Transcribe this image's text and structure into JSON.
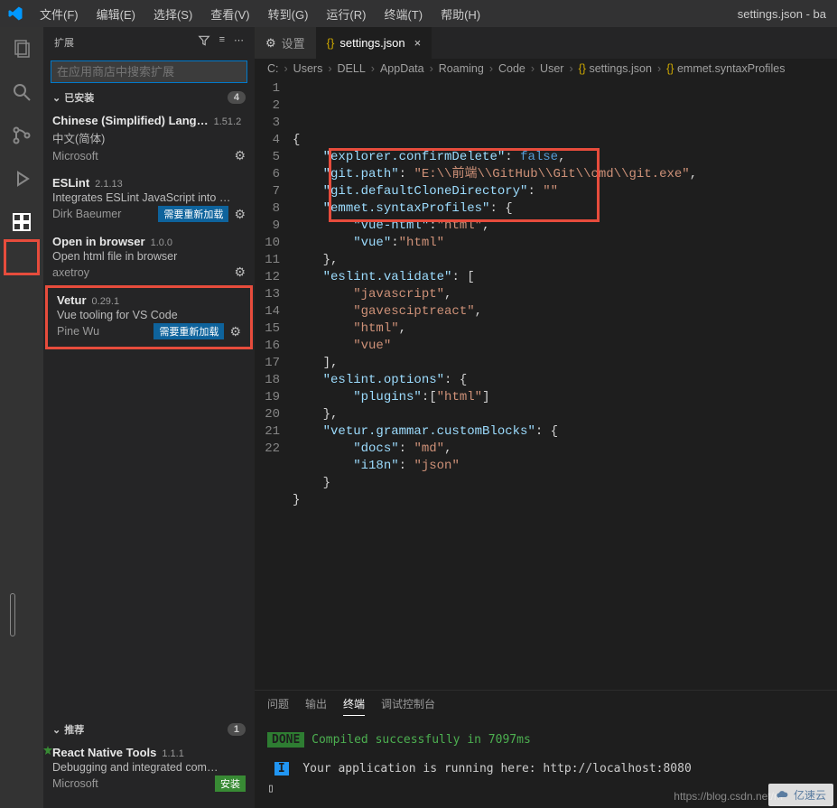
{
  "titlebar": {
    "menus": [
      "文件(F)",
      "编辑(E)",
      "选择(S)",
      "查看(V)",
      "转到(G)",
      "运行(R)",
      "终端(T)",
      "帮助(H)"
    ],
    "window_title": "settings.json - ba"
  },
  "sidebar": {
    "title": "扩展",
    "search_placeholder": "在应用商店中搜索扩展",
    "installed_label": "已安装",
    "installed_count": "4",
    "recommended_label": "推荐",
    "recommended_count": "1",
    "extensions": [
      {
        "name": "Chinese (Simplified) Lang…",
        "version": "1.51.2",
        "desc": "中文(简体)",
        "publisher": "Microsoft",
        "reload": false
      },
      {
        "name": "ESLint",
        "version": "2.1.13",
        "desc": "Integrates ESLint JavaScript into …",
        "publisher": "Dirk Baeumer",
        "reload": true
      },
      {
        "name": "Open in browser",
        "version": "1.0.0",
        "desc": "Open html file in browser",
        "publisher": "axetroy",
        "reload": false
      },
      {
        "name": "Vetur",
        "version": "0.29.1",
        "desc": "Vue tooling for VS Code",
        "publisher": "Pine Wu",
        "reload": true
      }
    ],
    "reload_label": "需要重新加载",
    "recommended_ext": {
      "name": "React Native Tools",
      "version": "1.1.1",
      "desc": "Debugging and integrated com…",
      "publisher": "Microsoft",
      "install_label": "安装"
    }
  },
  "tabs": {
    "settings_label": "设置",
    "json_label": "settings.json"
  },
  "breadcrumb": {
    "parts": [
      "C:",
      "Users",
      "DELL",
      "AppData",
      "Roaming",
      "Code",
      "User",
      "settings.json",
      "emmet.syntaxProfiles"
    ]
  },
  "code": {
    "lines": [
      {
        "n": "1",
        "t": "{"
      },
      {
        "n": "2",
        "t": "    \"explorer.confirmDelete\": false,",
        "keys": [
          "explorer.confirmDelete"
        ],
        "vals_kw": [
          "false"
        ]
      },
      {
        "n": "3",
        "t": "    \"git.path\": \"E:\\\\前端\\\\GitHub\\\\Git\\\\cmd\\\\git.exe\",",
        "keys": [
          "git.path"
        ],
        "vals": [
          "E:\\\\前端\\\\GitHub\\\\Git\\\\cmd\\\\git.exe"
        ]
      },
      {
        "n": "4",
        "t": "    \"git.defaultCloneDirectory\": \"\"",
        "keys": [
          "git.defaultCloneDirectory"
        ],
        "vals": [
          ""
        ]
      },
      {
        "n": "5",
        "t": "    \"emmet.syntaxProfiles\": {",
        "keys": [
          "emmet.syntaxProfiles"
        ]
      },
      {
        "n": "6",
        "t": "        \"vue-html\":\"html\",",
        "keys": [
          "vue-html"
        ],
        "vals": [
          "html"
        ]
      },
      {
        "n": "7",
        "t": "        \"vue\":\"html\"",
        "keys": [
          "vue"
        ],
        "vals": [
          "html"
        ]
      },
      {
        "n": "8",
        "t": "    },"
      },
      {
        "n": "9",
        "t": "    \"eslint.validate\": [",
        "keys": [
          "eslint.validate"
        ]
      },
      {
        "n": "10",
        "t": "        \"javascript\",",
        "vals": [
          "javascript"
        ]
      },
      {
        "n": "11",
        "t": "        \"gavesciptreact\",",
        "vals": [
          "gavesciptreact"
        ]
      },
      {
        "n": "12",
        "t": "        \"html\",",
        "vals": [
          "html"
        ]
      },
      {
        "n": "13",
        "t": "        \"vue\"",
        "vals": [
          "vue"
        ]
      },
      {
        "n": "14",
        "t": "    ],"
      },
      {
        "n": "15",
        "t": "    \"eslint.options\": {",
        "keys": [
          "eslint.options"
        ]
      },
      {
        "n": "16",
        "t": "        \"plugins\":[\"html\"]",
        "keys": [
          "plugins"
        ],
        "vals": [
          "html"
        ]
      },
      {
        "n": "17",
        "t": "    },"
      },
      {
        "n": "18",
        "t": "    \"vetur.grammar.customBlocks\": {",
        "keys": [
          "vetur.grammar.customBlocks"
        ]
      },
      {
        "n": "19",
        "t": "        \"docs\": \"md\",",
        "keys": [
          "docs"
        ],
        "vals": [
          "md"
        ]
      },
      {
        "n": "20",
        "t": "        \"i18n\": \"json\"",
        "keys": [
          "i18n"
        ],
        "vals": [
          "json"
        ]
      },
      {
        "n": "21",
        "t": "    }"
      },
      {
        "n": "22",
        "t": "}"
      }
    ]
  },
  "panel": {
    "tabs": [
      "问题",
      "输出",
      "终端",
      "调试控制台"
    ],
    "active": 2,
    "line1_badge": "DONE",
    "line1_text": "Compiled successfully in 7097ms",
    "line2_badge": "I",
    "line2_text": "Your application is running here: http://localhost:8080",
    "cursor": "▯"
  },
  "watermark": {
    "url": "https://blog.csdn.net/m",
    "brand": "亿速云"
  }
}
